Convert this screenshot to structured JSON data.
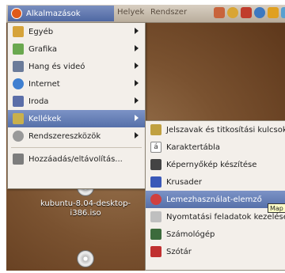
{
  "panel": {
    "apps_menu": "Alkalmazások",
    "places_menu": "Helyek",
    "system_menu": "Rendszer"
  },
  "desktop": {
    "iso_icon_label": "kubuntu-8.04-desktop-i386.iso"
  },
  "main_menu": {
    "items": [
      {
        "label": "Egyéb",
        "icon": "misc-icon",
        "color": "#d6a33a"
      },
      {
        "label": "Grafika",
        "icon": "graphics-icon",
        "color": "#6aa84f"
      },
      {
        "label": "Hang és videó",
        "icon": "sound-video-icon",
        "color": "#6b7b99"
      },
      {
        "label": "Internet",
        "icon": "internet-icon",
        "color": "#3f7fd0"
      },
      {
        "label": "Iroda",
        "icon": "office-icon",
        "color": "#5b6ea8"
      },
      {
        "label": "Kellékek",
        "icon": "accessories-icon",
        "color": "#c9b04c"
      },
      {
        "label": "Rendszereszközök",
        "icon": "system-tools-icon",
        "color": "#999999"
      },
      {
        "label": "Hozzáadás/eltávolítás...",
        "icon": "add-remove-icon",
        "color": "#7d7d7d"
      }
    ]
  },
  "sub_menu": {
    "items": [
      {
        "label": "Jelszavak és titkosítási kulcsok",
        "icon": "keys-icon",
        "color": "#c0a040"
      },
      {
        "label": "Karaktertábla",
        "icon": "charmap-icon",
        "color": "#ffffff",
        "glyph": "á"
      },
      {
        "label": "Képernyőkép készítése",
        "icon": "screenshot-icon",
        "color": "#444444"
      },
      {
        "label": "Krusader",
        "icon": "krusader-icon",
        "color": "#3a58b8"
      },
      {
        "label": "Lemezhasználat-elemző",
        "icon": "disk-usage-icon",
        "color": "#d04040"
      },
      {
        "label": "Nyomtatási feladatok kezelése",
        "icon": "print-jobs-icon",
        "color": "#bfbfbf"
      },
      {
        "label": "Számológép",
        "icon": "calculator-icon",
        "color": "#3c6b3c"
      },
      {
        "label": "Szótár",
        "icon": "dictionary-icon",
        "color": "#c03030"
      }
    ]
  },
  "tooltip": "Map"
}
